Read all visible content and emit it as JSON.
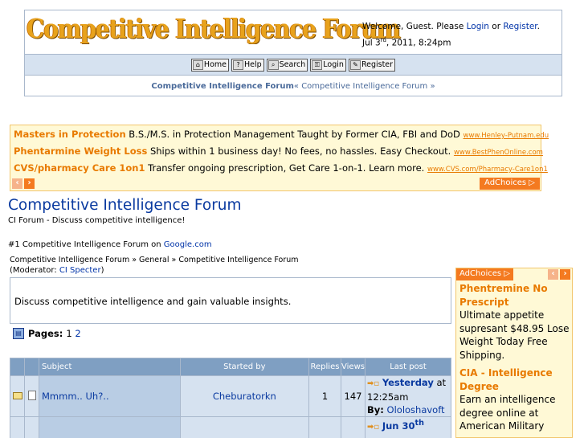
{
  "header": {
    "logo_text": "Competitive Intelligence Forum",
    "welcome_prefix": "Welcome, Guest. Please ",
    "login_link": "Login",
    "or_text": " or ",
    "register_link": "Register",
    "period": ".",
    "date_prefix": "Jul 3",
    "date_sup": "rd",
    "date_suffix": ", 2011, 8:24pm"
  },
  "menu": [
    {
      "label": "Home",
      "icon": "home-icon"
    },
    {
      "label": "Help",
      "icon": "help-icon"
    },
    {
      "label": "Search",
      "icon": "search-icon"
    },
    {
      "label": "Login",
      "icon": "login-icon"
    },
    {
      "label": "Register",
      "icon": "register-icon"
    }
  ],
  "top_breadcrumb": {
    "strong": "Competitive Intelligence Forum",
    "rest": " « Competitive Intelligence Forum »"
  },
  "ads_top": [
    {
      "title": "Masters in Protection",
      "text": " B.S./M.S. in Protection Management Taught by Former CIA, FBI and DoD ",
      "url": "www.Henley-Putnam.edu"
    },
    {
      "title": "Phentarmine Weight Loss",
      "text": " Ships within 1 business day! No fees, no hassles. Easy Checkout. ",
      "url": "www.BestPhenOnline.com"
    },
    {
      "title": "CVS/pharmacy Care 1on1",
      "text": " Transfer ongoing prescription, Get Care 1-on-1. Learn more. ",
      "url": "www.CVS.com/Pharmacy-Care1on1"
    }
  ],
  "adchoices_label": "AdChoices",
  "forum": {
    "title": "Competitive Intelligence Forum",
    "subtitle": "CI Forum - Discuss competitive intelligence!",
    "google_prefix": "#1 Competitive Intelligence Forum on ",
    "google_link": "Google.com",
    "crumbs": "Competitive Intelligence Forum » General » Competitive Intelligence Forum",
    "moderator_prefix": "(Moderator: ",
    "moderator_link": "CI Specter",
    "moderator_suffix": ")",
    "description": "Discuss competitive intelligence and gain valuable insights.",
    "pages_label": "Pages:",
    "page_1": "1",
    "page_2": "2"
  },
  "table": {
    "headers": {
      "subject": "Subject",
      "started_by": "Started by",
      "replies": "Replies",
      "views": "Views",
      "last_post": "Last post"
    },
    "rows": [
      {
        "subject": "Mmmm.. Uh?..",
        "started_by": "Cheburatorkn",
        "replies": "1",
        "views": "147",
        "last_when": "Yesterday",
        "last_at": " at 12:25am",
        "by_label": "By:",
        "by_user": "Ololoshavoft"
      },
      {
        "subject": "",
        "started_by": "",
        "replies": "",
        "views": "",
        "last_when": "Jun 30",
        "last_sup": "th"
      }
    ]
  },
  "ads_right": [
    {
      "title": "Phentremine No Prescript",
      "text": "Ultimate appetite supresant $48.95 Lose Weight Today Free Shipping."
    },
    {
      "title": "CIA - Intelligence Degree",
      "text": "Earn an intelligence degree online at American Military"
    }
  ]
}
